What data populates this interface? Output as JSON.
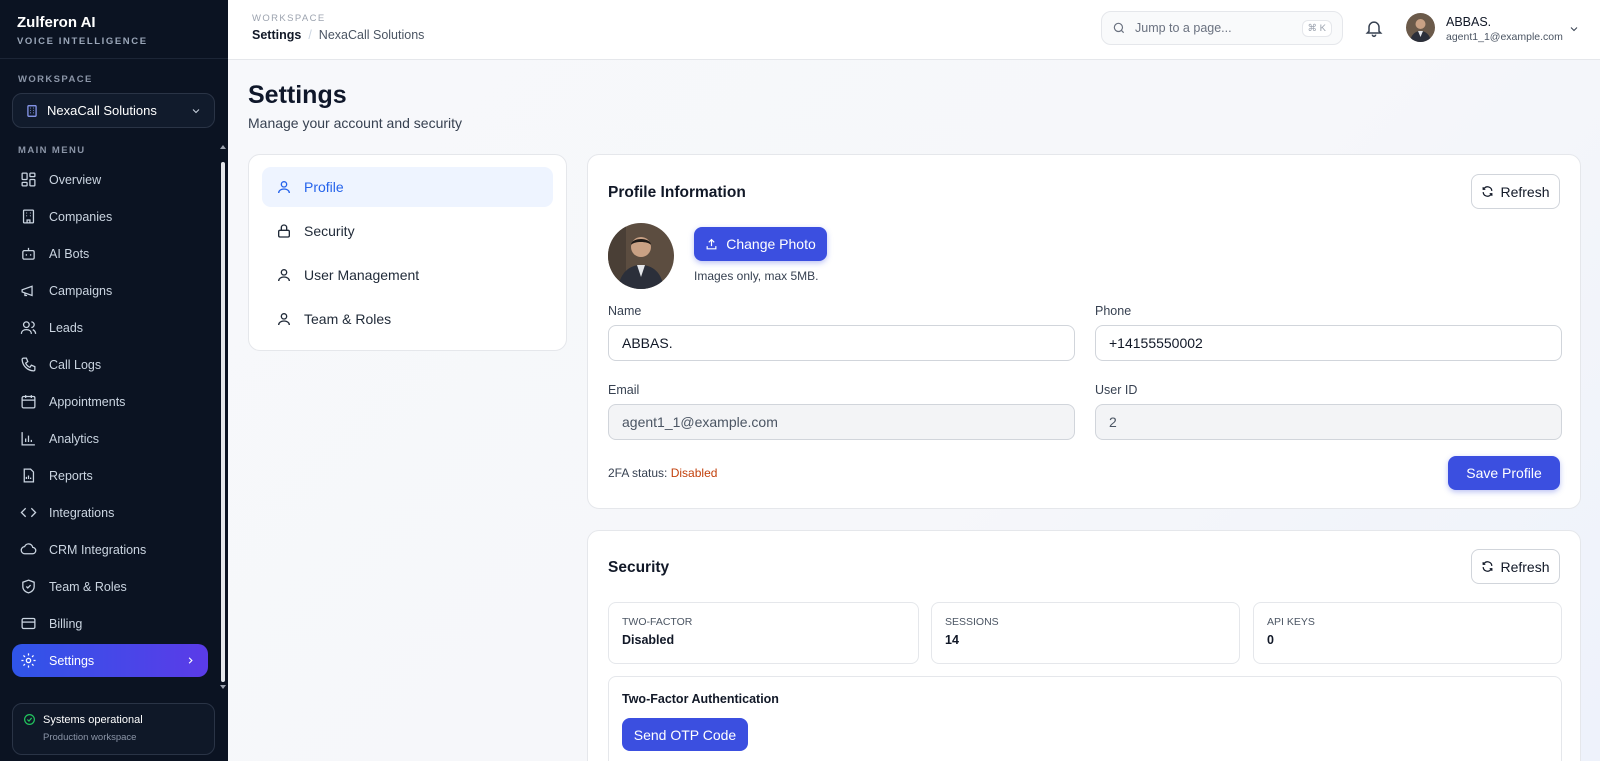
{
  "brand": {
    "name": "Zulferon AI",
    "tagline": "VOICE INTELLIGENCE"
  },
  "sidebar": {
    "workspace_label": "WORKSPACE",
    "workspace_selected": "NexaCall Solutions",
    "menu_label": "MAIN MENU",
    "items": [
      {
        "label": "Overview",
        "icon": "grid-icon"
      },
      {
        "label": "Companies",
        "icon": "building-icon"
      },
      {
        "label": "AI Bots",
        "icon": "bot-icon"
      },
      {
        "label": "Campaigns",
        "icon": "megaphone-icon"
      },
      {
        "label": "Leads",
        "icon": "users-icon"
      },
      {
        "label": "Call Logs",
        "icon": "phone-icon"
      },
      {
        "label": "Appointments",
        "icon": "calendar-icon"
      },
      {
        "label": "Analytics",
        "icon": "bar-chart-icon"
      },
      {
        "label": "Reports",
        "icon": "report-icon"
      },
      {
        "label": "Integrations",
        "icon": "code-icon"
      },
      {
        "label": "CRM Integrations",
        "icon": "cloud-icon"
      },
      {
        "label": "Team & Roles",
        "icon": "shield-icon"
      },
      {
        "label": "Billing",
        "icon": "credit-card-icon"
      },
      {
        "label": "Settings",
        "icon": "gear-icon",
        "active": true
      }
    ],
    "status": {
      "title": "Systems operational",
      "subtitle": "Production workspace",
      "color": "#22c55e"
    }
  },
  "header": {
    "workspace_label": "WORKSPACE",
    "breadcrumb": [
      "Settings",
      "NexaCall Solutions"
    ],
    "search": {
      "placeholder": "Jump to a page...",
      "shortcut": "⌘ K"
    },
    "user": {
      "name": "ABBAS.",
      "email": "agent1_1@example.com"
    }
  },
  "page": {
    "title": "Settings",
    "subtitle": "Manage your account and security"
  },
  "tabs": [
    {
      "label": "Profile",
      "icon": "user-icon",
      "active": true
    },
    {
      "label": "Security",
      "icon": "lock-icon"
    },
    {
      "label": "User Management",
      "icon": "user-icon"
    },
    {
      "label": "Team & Roles",
      "icon": "user-icon"
    }
  ],
  "profile": {
    "title": "Profile Information",
    "refresh_label": "Refresh",
    "change_photo_label": "Change Photo",
    "photo_hint": "Images only, max 5MB.",
    "fields": {
      "name": {
        "label": "Name",
        "value": "ABBAS."
      },
      "phone": {
        "label": "Phone",
        "value": "+14155550002"
      },
      "email": {
        "label": "Email",
        "value": "agent1_1@example.com"
      },
      "user_id": {
        "label": "User ID",
        "value": "2"
      }
    },
    "twofa_label": "2FA status:",
    "twofa_value": "Disabled",
    "save_label": "Save Profile"
  },
  "security": {
    "title": "Security",
    "refresh_label": "Refresh",
    "stats": [
      {
        "key": "TWO-FACTOR",
        "value": "Disabled"
      },
      {
        "key": "SESSIONS",
        "value": "14"
      },
      {
        "key": "API KEYS",
        "value": "0"
      }
    ],
    "twofa_section_title": "Two-Factor Authentication",
    "otp_label": "Send OTP Code"
  },
  "colors": {
    "accent": "#3b4fe0",
    "sidebar_bg": "#0b1322",
    "warning": "#c2410c"
  }
}
